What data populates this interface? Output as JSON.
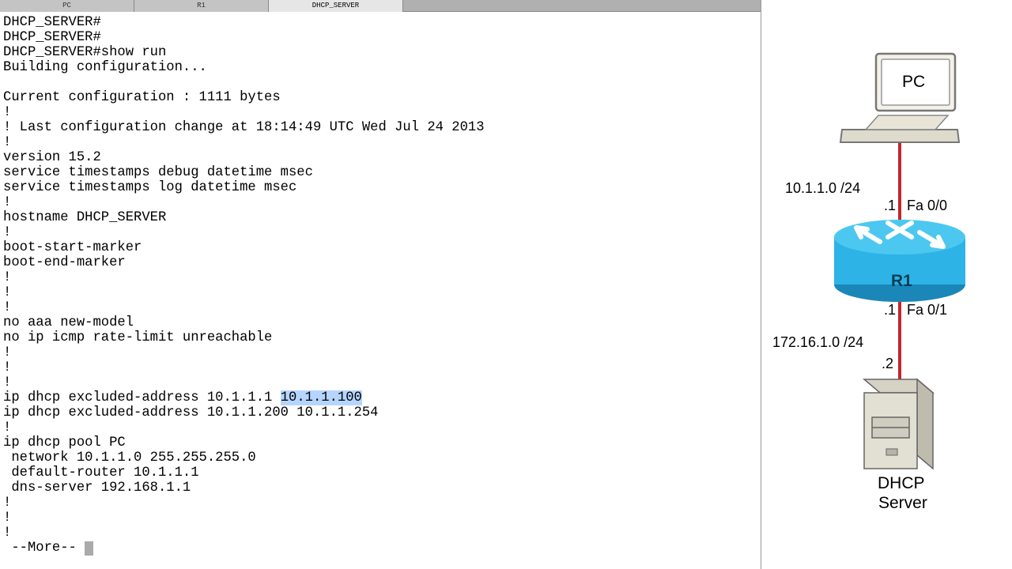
{
  "tabs": [
    {
      "label": "PC",
      "active": false
    },
    {
      "label": "R1",
      "active": false
    },
    {
      "label": "DHCP_SERVER",
      "active": true
    }
  ],
  "terminal": {
    "lines_before_highlight": "DHCP_SERVER#\nDHCP_SERVER#\nDHCP_SERVER#show run\nBuilding configuration...\n\nCurrent configuration : 1111 bytes\n!\n! Last configuration change at 18:14:49 UTC Wed Jul 24 2013\n!\nversion 15.2\nservice timestamps debug datetime msec\nservice timestamps log datetime msec\n!\nhostname DHCP_SERVER\n!\nboot-start-marker\nboot-end-marker\n!\n!\n!\nno aaa new-model\nno ip icmp rate-limit unreachable\n!\n!\n!\nip dhcp excluded-address 10.1.1.1 ",
    "highlight": "10.1.1.100",
    "lines_after_highlight": "\nip dhcp excluded-address 10.1.1.200 10.1.1.254\n!\nip dhcp pool PC\n network 10.1.1.0 255.255.255.0\n default-router 10.1.1.1\n dns-server 192.168.1.1\n!\n!\n!\n --More-- "
  },
  "diagram": {
    "pc_label": "PC",
    "router_label": "R1",
    "server_label_1": "DHCP",
    "server_label_2": "Server",
    "net_top": "10.1.1.0 /24",
    "if_top": "Fa 0/0",
    "ip_top": ".1",
    "if_bottom": "Fa 0/1",
    "ip_bottom": ".1",
    "net_bottom": "172.16.1.0 /24",
    "ip_server": ".2"
  }
}
